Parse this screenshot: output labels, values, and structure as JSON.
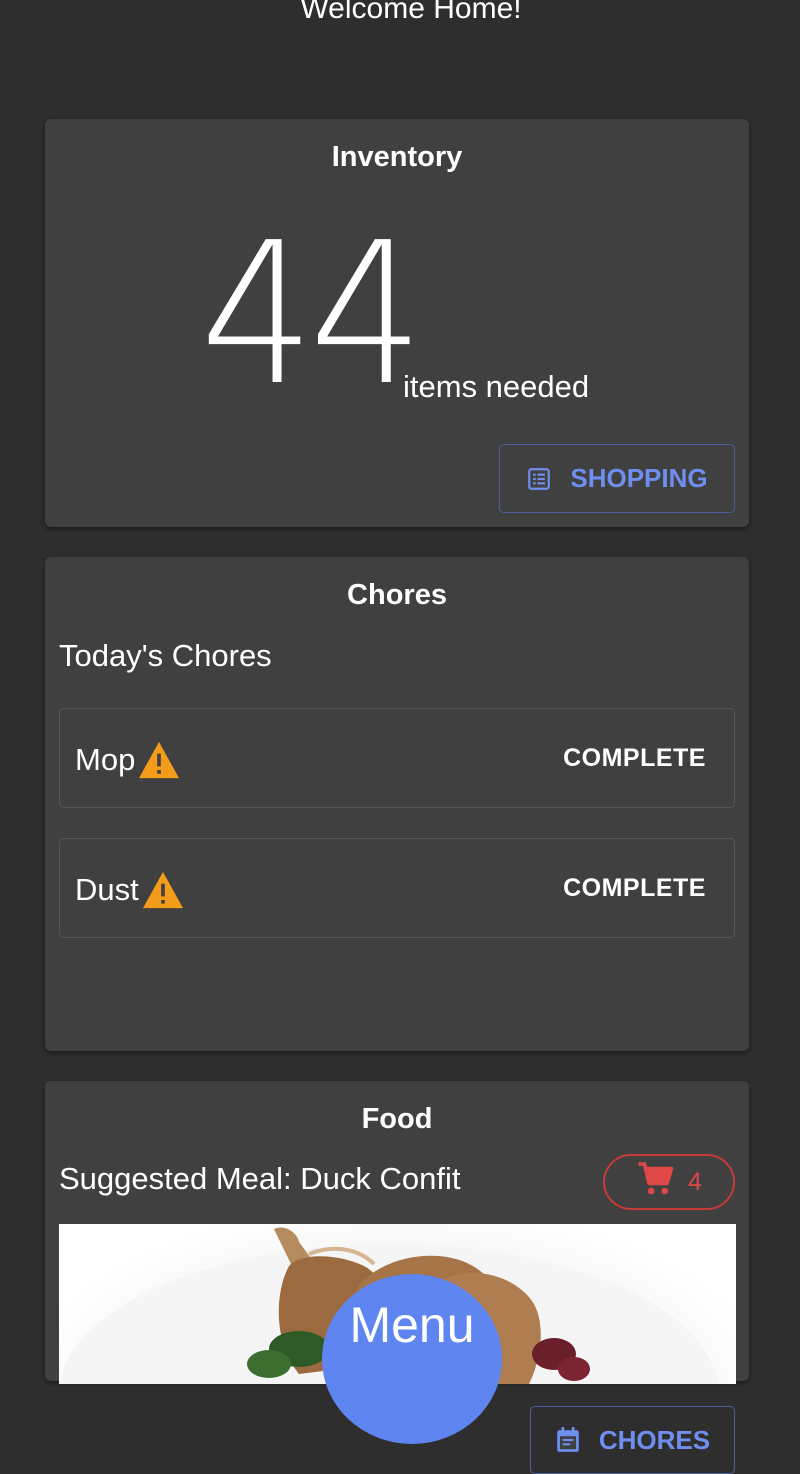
{
  "header": {
    "welcome": "Welcome Home!"
  },
  "inventory": {
    "title": "Inventory",
    "count": "44",
    "count_label": "items needed",
    "button_label": "SHOPPING",
    "button_icon": "list-icon"
  },
  "chores": {
    "title": "Chores",
    "subtitle": "Today's Chores",
    "items": [
      {
        "name": "Mop",
        "status_icon": "warning-icon",
        "action": "COMPLETE"
      },
      {
        "name": "Dust",
        "status_icon": "warning-icon",
        "action": "COMPLETE"
      }
    ],
    "button_label": "CHORES",
    "button_icon": "calendar-icon"
  },
  "food": {
    "title": "Food",
    "subtitle": "Suggested Meal: Duck Confit",
    "cart_count": "4",
    "cart_icon": "cart-icon"
  },
  "menu": {
    "label": "Menu"
  },
  "colors": {
    "background": "#2e2e2e",
    "card": "#404040",
    "accent_blue": "#6e8ff0",
    "warning": "#f39c1a",
    "cart_red": "#e04848",
    "menu_fab": "#5f86f0"
  }
}
